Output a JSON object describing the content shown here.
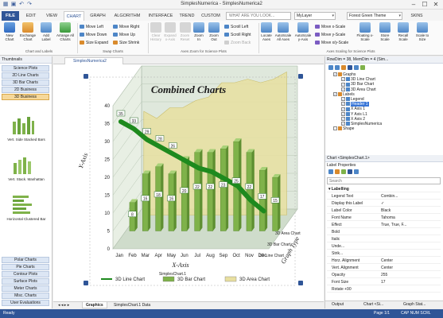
{
  "window": {
    "title": "SimplesNumerica - SimplesNumerica2",
    "minimize": "–",
    "maximize": "☐",
    "close": "✕"
  },
  "ribbon_tabs": [
    "FILE",
    "EDIT",
    "VIEW",
    "CHART",
    "GRAPH",
    "ALGORITHM",
    "INTERFACE",
    "TREND",
    "CUSTOM"
  ],
  "active_tab": "CHART",
  "search": {
    "placeholder": "WHAT ARE YOU LOOK..."
  },
  "layer_combo": "MyLayer",
  "theme_combo": "Forest Green Theme",
  "skins_label": "SKINS",
  "ribbon": {
    "chart_and_labels": {
      "new_chart": "New Chart",
      "exchange_chart": "Exchange Chart",
      "add_label": "Add Label",
      "arrange_all_charts": "Arrange All Charts",
      "group_label": "Chart and Labels"
    },
    "swap_charts": {
      "move_left": "Move Left",
      "move_right": "Move Right",
      "move_down": "Move Down",
      "move_up": "Move Up",
      "size_expand": "Size Expand",
      "size_shrink": "Size Shrink",
      "group_label": "Swap Charts"
    },
    "axes_zoom": {
      "clear_history": "Clear History",
      "expand_x_axis": "Expand x-Axis",
      "zoom_in_reset": "Zoom Reset",
      "zoom_in": "Zoom In",
      "zoom_out": "Zoom Out",
      "scroll_left": "Scroll Left",
      "scroll_right": "Scroll Right",
      "zoom_back": "Zoom Back",
      "group_label": "Axes Zoom for Science Plots"
    },
    "axes_scaling": {
      "locate_axes": "Locate Axes",
      "autoscale_all": "AutoScale All Axes",
      "autoscale_y": "AutoScale y-Axis",
      "move_x_scale": "Move x-Scale",
      "move_y_scale": "Move y-Scale",
      "move_xy_scale": "Move x/y-Scale",
      "floating_x_scale": "Floating x-Scale",
      "store_scale": "Store Scale",
      "recall_scale": "Recall Scale",
      "scale_to_size": "Scale to Size",
      "group_label": "Axes Scaling for Science Plots"
    }
  },
  "left_panel": {
    "title": "Thumbnails",
    "top_categories": [
      "Science Plots",
      "2D Line Charts",
      "3D Bar Charts",
      "2D Business",
      "3D Business"
    ],
    "selected_category": "3D Business",
    "thumbnails": [
      "Vert. Side Stacked Bars",
      "Vert. Stack. Manhattan",
      "Horizontal Clustered Bar"
    ],
    "bottom_categories": [
      "Polar Charts",
      "Pie Charts",
      "Contour Plots",
      "Surface Plots",
      "Meter Charts",
      "Misc. Charts",
      "User Evaluations"
    ]
  },
  "document_tab": "SimplesNumerica2",
  "bottom_tabs": [
    "Graphics",
    "SimplesChart.1 Data"
  ],
  "chart_data": {
    "type": "bar",
    "title": "Combined Charts",
    "xlabel": "X-Axis",
    "ylabel": "Y-Axis",
    "zlabel": "Graph Type",
    "ylim": [
      0,
      40
    ],
    "yticks": [
      0,
      5,
      10,
      15,
      20,
      25,
      30,
      35,
      40
    ],
    "categories": [
      "Jan",
      "Feb",
      "Mar",
      "Apr",
      "May",
      "Jun",
      "Jul",
      "Aug",
      "Sep",
      "Oct",
      "Nov",
      "Dec"
    ],
    "series": [
      {
        "name": "3D Line Chart",
        "type": "line",
        "values": [
          35,
          33,
          30,
          28,
          26,
          24,
          22,
          21,
          19,
          17,
          13,
          10
        ]
      },
      {
        "name": "3D Bar Chart",
        "type": "bar",
        "values": [
          8,
          16,
          18,
          16,
          20,
          22,
          22,
          23,
          25,
          22,
          17,
          15
        ]
      },
      {
        "name": "3D Area Chart",
        "type": "area",
        "values": [
          29,
          27,
          30,
          30,
          32,
          33,
          37,
          37,
          38,
          37,
          38,
          40
        ]
      }
    ],
    "bar_data_labels": [
      8,
      16,
      18,
      16,
      20,
      22,
      22,
      23,
      25,
      22,
      17,
      15
    ],
    "line_data_labels": [
      35,
      33,
      29,
      28,
      26
    ],
    "series_axis_labels": [
      "3D Area Chart",
      "3D Bar Chart",
      "3D Line Chart"
    ],
    "legend": [
      "3D Line Chart",
      "3D Bar Chart",
      "3D Area Chart"
    ],
    "legend_caption": "SimplesChart.1",
    "legend_position": "bottom",
    "colors": {
      "bar": "#7fb24a",
      "line": "#1e8a1e",
      "area": "#e8dfa0",
      "wall": "#dfe8dc"
    }
  },
  "right_panel": {
    "title": "RowDim = 38, MemDim = 4 (Sim...",
    "tree": [
      {
        "label": "Graphs",
        "level": 0,
        "checked": true
      },
      {
        "label": "3D Line Chart",
        "level": 1,
        "checked": true
      },
      {
        "label": "3D Bar Chart",
        "level": 1,
        "checked": true
      },
      {
        "label": "3D Area Chart",
        "level": 1,
        "checked": true
      },
      {
        "label": "Labels",
        "level": 0,
        "checked": true
      },
      {
        "label": "Legend",
        "level": 1,
        "checked": true
      },
      {
        "label": "Header 1",
        "level": 1,
        "checked": true,
        "selected": true
      },
      {
        "label": "X Axis 1",
        "level": 1,
        "checked": true
      },
      {
        "label": "Y Axis L1",
        "level": 1,
        "checked": true
      },
      {
        "label": "X Axis 2",
        "level": 1,
        "checked": true
      },
      {
        "label": "SimplesNumerica",
        "level": 1,
        "checked": true
      },
      {
        "label": "Shape",
        "level": 0,
        "checked": false
      }
    ],
    "properties_title": "Chart <SimplesChart.1>",
    "properties_subtitle": "Label Properties",
    "search_placeholder": "Search",
    "properties": [
      {
        "name": "Labelling",
        "value": "",
        "header": true
      },
      {
        "name": "Legend Text",
        "value": "Combin..."
      },
      {
        "name": "Display this Label",
        "value": "✓"
      },
      {
        "name": "Label Color",
        "value": "Black"
      },
      {
        "name": "Font Name",
        "value": "Tahoma"
      },
      {
        "name": "Effect",
        "value": "True, True, F..."
      },
      {
        "name": "Bold",
        "value": ""
      },
      {
        "name": "Italic",
        "value": ""
      },
      {
        "name": "Unde...",
        "value": ""
      },
      {
        "name": "Strik...",
        "value": ""
      },
      {
        "name": "Horz. Alignment",
        "value": "Center"
      },
      {
        "name": "Vert. Alignment",
        "value": "Center"
      },
      {
        "name": "Opacity",
        "value": "255"
      },
      {
        "name": "Font Size",
        "value": "17"
      },
      {
        "name": "Rotate +90",
        "value": ""
      }
    ],
    "bottom_tabs": [
      "Output",
      "Chart <Si...",
      "Graph Stat..."
    ]
  },
  "status": {
    "left": "Ready",
    "page": "Page 1/1",
    "indicators": "CAP  NUM  SCRL"
  }
}
